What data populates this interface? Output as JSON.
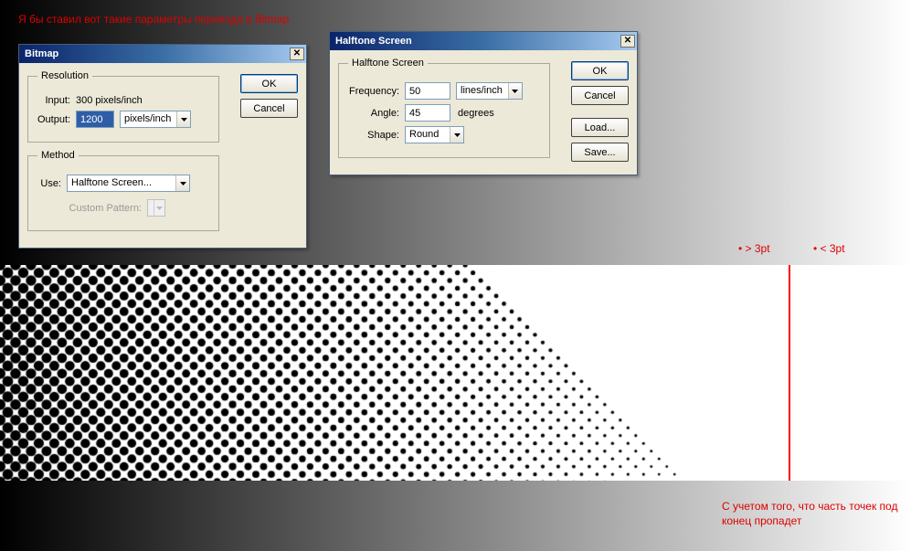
{
  "annotations": {
    "top": "Я бы ставил вот такие параметры перевода в Bitmap",
    "gt3pt": "• > 3pt",
    "lt3pt": "• < 3pt",
    "bottom": "С учетом того, что часть точек под конец пропадет"
  },
  "bitmap": {
    "title": "Bitmap",
    "ok": "OK",
    "cancel": "Cancel",
    "resolution": {
      "legend": "Resolution",
      "input_label": "Input:",
      "input_value": "300 pixels/inch",
      "output_label": "Output:",
      "output_value": "1200",
      "output_units": "pixels/inch"
    },
    "method": {
      "legend": "Method",
      "use_label": "Use:",
      "use_value": "Halftone Screen...",
      "custom_label": "Custom Pattern:"
    }
  },
  "halftone": {
    "title": "Halftone Screen",
    "legend": "Halftone Screen",
    "ok": "OK",
    "cancel": "Cancel",
    "load": "Load...",
    "save": "Save...",
    "freq_label": "Frequency:",
    "freq_value": "50",
    "freq_units": "lines/inch",
    "angle_label": "Angle:",
    "angle_value": "45",
    "angle_units": "degrees",
    "shape_label": "Shape:",
    "shape_value": "Round"
  }
}
